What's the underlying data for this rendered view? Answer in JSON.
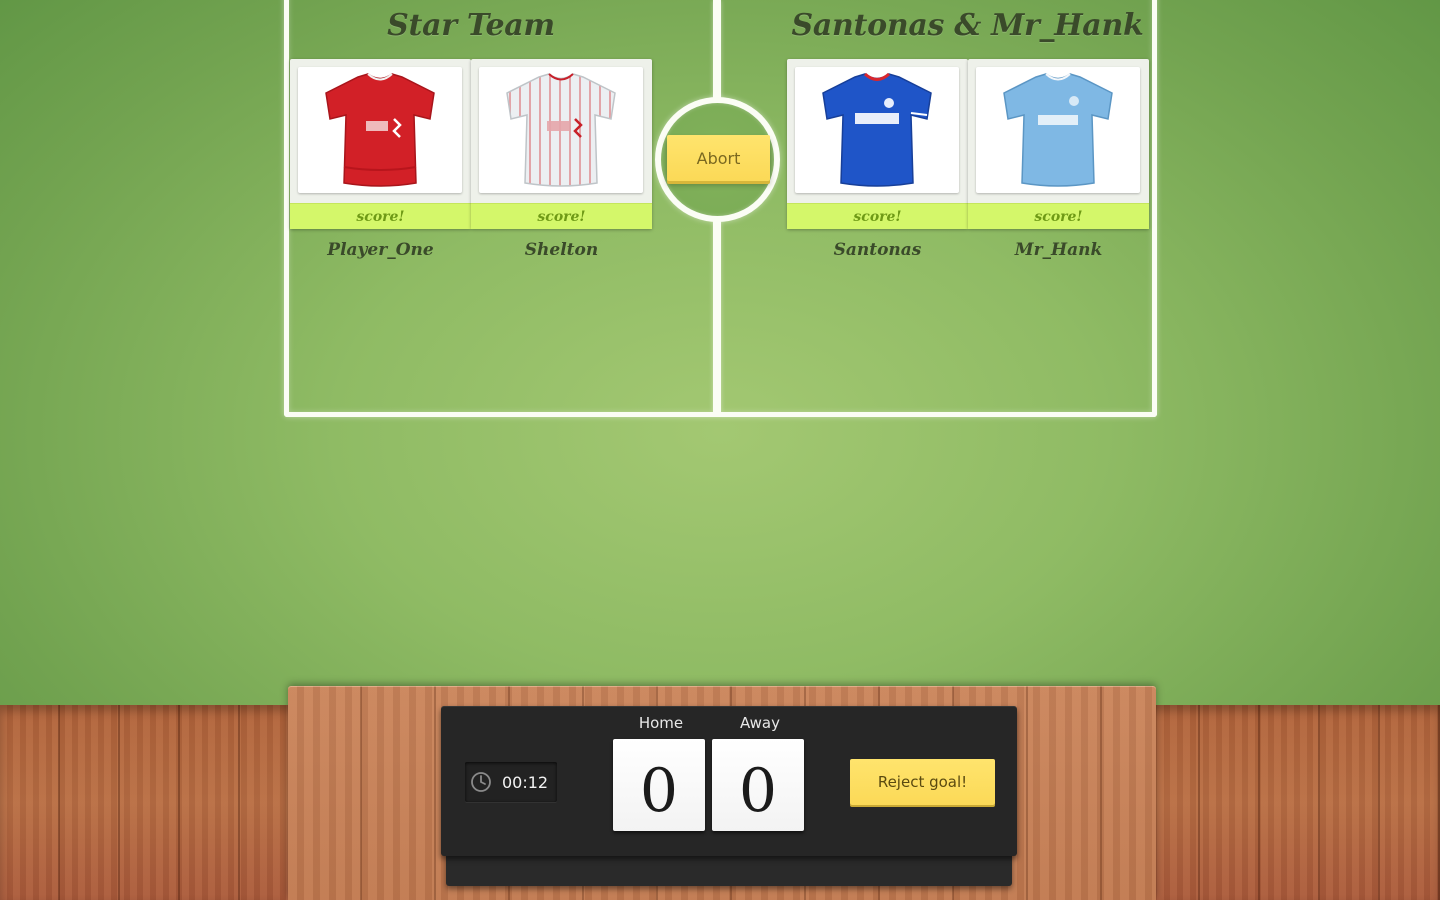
{
  "teams": {
    "home": {
      "name": "Star Team",
      "players": [
        {
          "name": "Player_One",
          "score_label": "score!",
          "jersey": "liverpool-home-jersey",
          "jersey_color": "#d22027"
        },
        {
          "name": "Shelton",
          "score_label": "score!",
          "jersey": "liverpool-away-jersey",
          "jersey_color": "#eceff2"
        }
      ]
    },
    "away": {
      "name": "Santonas & Mr_Hank",
      "players": [
        {
          "name": "Santonas",
          "score_label": "score!",
          "jersey": "chelsea-home-jersey",
          "jersey_color": "#1f55c8"
        },
        {
          "name": "Mr_Hank",
          "score_label": "score!",
          "jersey": "man-city-home-jersey",
          "jersey_color": "#7fb8e4"
        }
      ]
    }
  },
  "controls": {
    "abort_label": "Abort",
    "reject_goal_label": "Reject goal!"
  },
  "scoreboard": {
    "timer": "00:12",
    "home_label": "Home",
    "away_label": "Away",
    "home_score": "0",
    "away_score": "0"
  },
  "colors": {
    "accent_button": "#fbd957",
    "score_strip": "#d4f76a",
    "pitch": "#8fbb64"
  }
}
